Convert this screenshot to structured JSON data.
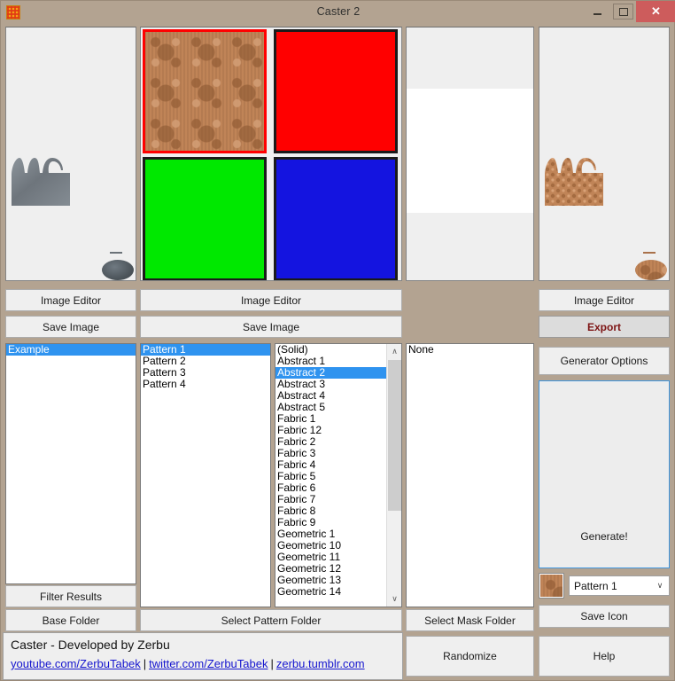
{
  "window": {
    "title": "Caster 2",
    "icon": "checkered-pattern-icon",
    "minimize_label": "–",
    "maximize_label": "❑",
    "close_label": "✕"
  },
  "previews": {
    "base_panel_name": "base-image-preview",
    "pattern_panel_name": "pattern-swatch-preview",
    "mask_panel_name": "mask-image-preview",
    "output_panel_name": "output-image-preview"
  },
  "swatches": [
    {
      "name": "swatch-damask",
      "kind": "pattern",
      "selected": true,
      "color": ""
    },
    {
      "name": "swatch-red",
      "kind": "solid",
      "selected": false,
      "color": "#ff0000"
    },
    {
      "name": "swatch-green",
      "kind": "solid",
      "selected": false,
      "color": "#00e800"
    },
    {
      "name": "swatch-blue",
      "kind": "solid",
      "selected": false,
      "color": "#1414e0"
    }
  ],
  "buttons": {
    "image_editor_base": "Image Editor",
    "image_editor_pattern": "Image Editor",
    "image_editor_output": "Image Editor",
    "save_image_base": "Save Image",
    "save_image_pattern": "Save Image",
    "export": "Export",
    "generator_options": "Generator Options",
    "generate": "Generate!",
    "filter_results": "Filter Results",
    "base_folder": "Base Folder",
    "select_pattern_folder": "Select Pattern Folder",
    "select_mask_folder": "Select Mask Folder",
    "randomize": "Randomize",
    "save_icon": "Save Icon",
    "help": "Help"
  },
  "base_list": {
    "name": "base-image-list",
    "items": [
      "Example"
    ],
    "selected_index": 0
  },
  "pattern_list": {
    "name": "pattern-list",
    "items": [
      "Pattern 1",
      "Pattern 2",
      "Pattern 3",
      "Pattern 4"
    ],
    "selected_index": 0
  },
  "texture_list": {
    "name": "texture-list",
    "items": [
      "(Solid)",
      "Abstract 1",
      "Abstract 2",
      "Abstract 3",
      "Abstract 4",
      "Abstract 5",
      "Fabric 1",
      "Fabric 12",
      "Fabric 2",
      "Fabric 3",
      "Fabric 4",
      "Fabric 5",
      "Fabric 6",
      "Fabric 7",
      "Fabric 8",
      "Fabric 9",
      "Geometric 1",
      "Geometric 10",
      "Geometric 11",
      "Geometric 12",
      "Geometric 13",
      "Geometric 14"
    ],
    "selected_index": 2,
    "scroll_up_glyph": "∧",
    "scroll_down_glyph": "∨"
  },
  "mask_list": {
    "name": "mask-list",
    "items": [
      "None"
    ],
    "selected_index": -1
  },
  "icon_combo": {
    "value": "Pattern 1",
    "chevron": "∨"
  },
  "footer": {
    "credit": "Caster - Developed by Zerbu",
    "links": [
      "youtube.com/ZerbuTabek",
      "twitter.com/ZerbuTabek",
      "zerbu.tumblr.com"
    ],
    "separator": "|"
  },
  "colors": {
    "window_chrome": "#b3a391",
    "close_button": "#cd5c5c",
    "selection_blue": "#2f93ef",
    "export_text": "#7d1414",
    "generate_border": "#3f96e0",
    "link": "#1515cf",
    "selected_swatch_border": "#ff0000"
  }
}
